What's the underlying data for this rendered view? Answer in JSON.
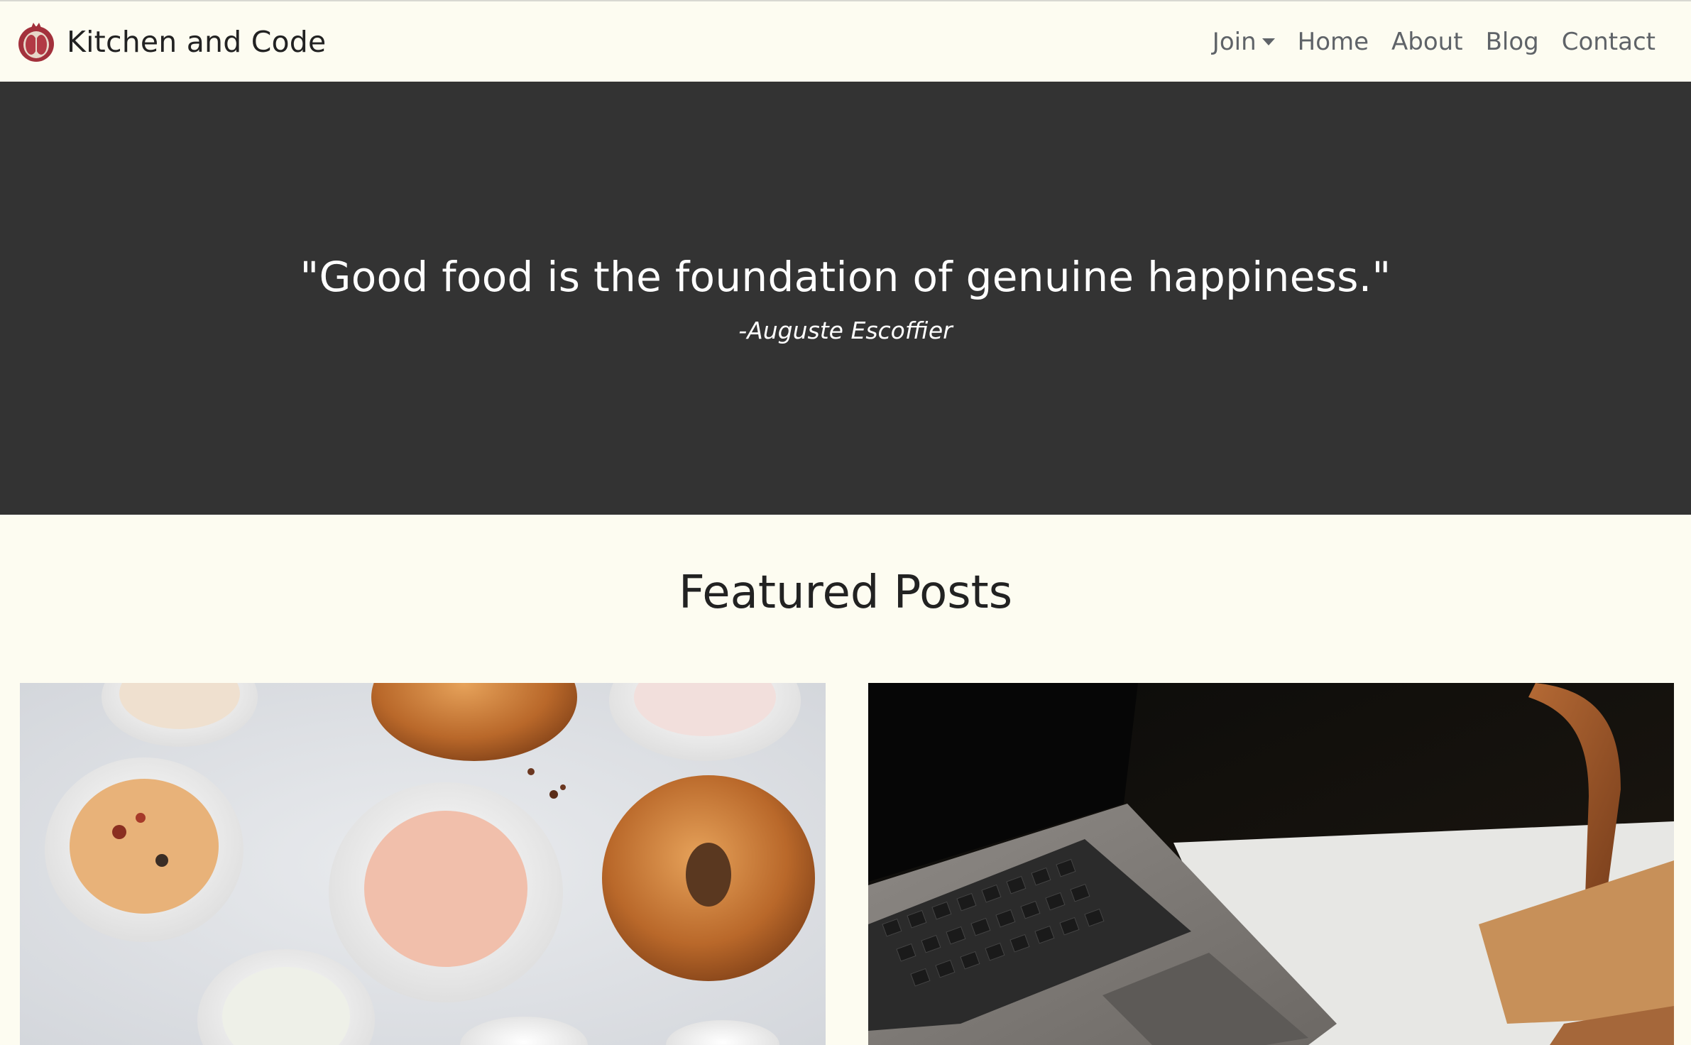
{
  "navbar": {
    "brand": "Kitchen and Code",
    "links": {
      "join": "Join",
      "home": "Home",
      "about": "About",
      "blog": "Blog",
      "contact": "Contact"
    }
  },
  "hero": {
    "quote": "\"Good food is the foundation of genuine happiness.\"",
    "author": "-Auguste Escoffier"
  },
  "featured": {
    "title": "Featured Posts"
  },
  "icons": {
    "brand": "pomegranate-icon",
    "join_dropdown": "caret-down-icon"
  },
  "colors": {
    "page_background": "#fdfcf1",
    "hero_background": "#333333",
    "nav_text": "#5f6368",
    "brand_accent": "#9e2f3b"
  }
}
